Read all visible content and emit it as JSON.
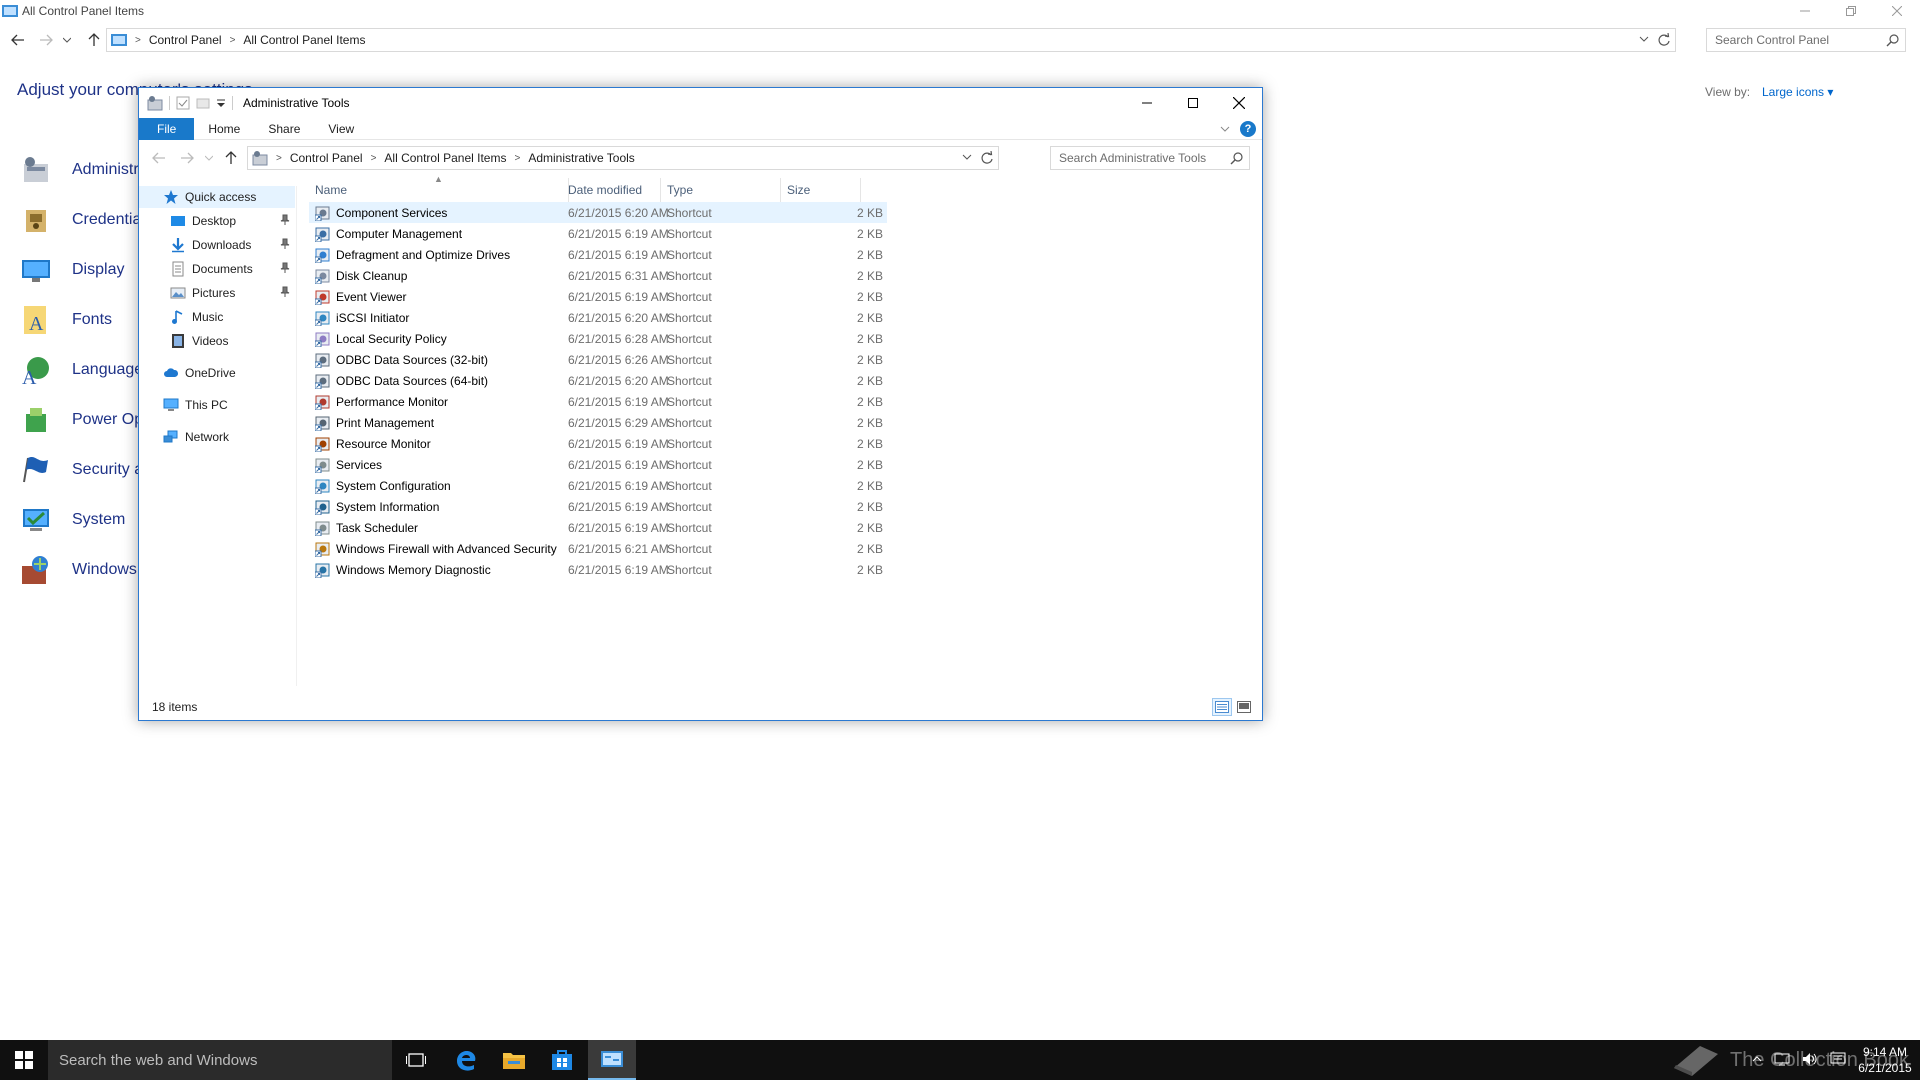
{
  "background_window": {
    "title": "All Control Panel Items",
    "address": [
      "Control Panel",
      "All Control Panel Items"
    ],
    "search_placeholder": "Search Control Panel",
    "heading": "Adjust your computer's settings",
    "view_by_label": "View by:",
    "view_by_value": "Large icons",
    "items": [
      {
        "label": "Administrative Tools",
        "icon": "admin-tools-icon"
      },
      {
        "label": "Credential Manager",
        "icon": "credential-icon"
      },
      {
        "label": "Display",
        "icon": "display-icon"
      },
      {
        "label": "Fonts",
        "icon": "fonts-icon"
      },
      {
        "label": "Language",
        "icon": "language-icon"
      },
      {
        "label": "Power Options",
        "icon": "power-icon"
      },
      {
        "label": "Security and Maintenance",
        "icon": "flag-icon"
      },
      {
        "label": "System",
        "icon": "system-icon"
      },
      {
        "label": "Windows Firewall",
        "icon": "firewall-icon"
      }
    ]
  },
  "explorer": {
    "title": "Administrative Tools",
    "ribbon_tabs": [
      "File",
      "Home",
      "Share",
      "View"
    ],
    "address": [
      "Control Panel",
      "All Control Panel Items",
      "Administrative Tools"
    ],
    "search_placeholder": "Search Administrative Tools",
    "nav": [
      {
        "label": "Quick access",
        "icon": "star-icon",
        "pinned": false
      },
      {
        "label": "Desktop",
        "icon": "desktop-icon",
        "pinned": true
      },
      {
        "label": "Downloads",
        "icon": "download-icon",
        "pinned": true
      },
      {
        "label": "Documents",
        "icon": "documents-icon",
        "pinned": true
      },
      {
        "label": "Pictures",
        "icon": "pictures-icon",
        "pinned": true
      },
      {
        "label": "Music",
        "icon": "music-icon",
        "pinned": false
      },
      {
        "label": "Videos",
        "icon": "videos-icon",
        "pinned": false
      },
      {
        "label": "OneDrive",
        "icon": "cloud-icon",
        "pinned": false
      },
      {
        "label": "This PC",
        "icon": "computer-icon",
        "pinned": false
      },
      {
        "label": "Network",
        "icon": "network-icon",
        "pinned": false
      }
    ],
    "columns": [
      "Name",
      "Date modified",
      "Type",
      "Size"
    ],
    "files": [
      {
        "name": "Component Services",
        "date": "6/21/2015 6:20 AM",
        "type": "Shortcut",
        "size": "2 KB"
      },
      {
        "name": "Computer Management",
        "date": "6/21/2015 6:19 AM",
        "type": "Shortcut",
        "size": "2 KB"
      },
      {
        "name": "Defragment and Optimize Drives",
        "date": "6/21/2015 6:19 AM",
        "type": "Shortcut",
        "size": "2 KB"
      },
      {
        "name": "Disk Cleanup",
        "date": "6/21/2015 6:31 AM",
        "type": "Shortcut",
        "size": "2 KB"
      },
      {
        "name": "Event Viewer",
        "date": "6/21/2015 6:19 AM",
        "type": "Shortcut",
        "size": "2 KB"
      },
      {
        "name": "iSCSI Initiator",
        "date": "6/21/2015 6:20 AM",
        "type": "Shortcut",
        "size": "2 KB"
      },
      {
        "name": "Local Security Policy",
        "date": "6/21/2015 6:28 AM",
        "type": "Shortcut",
        "size": "2 KB"
      },
      {
        "name": "ODBC Data Sources (32-bit)",
        "date": "6/21/2015 6:26 AM",
        "type": "Shortcut",
        "size": "2 KB"
      },
      {
        "name": "ODBC Data Sources (64-bit)",
        "date": "6/21/2015 6:20 AM",
        "type": "Shortcut",
        "size": "2 KB"
      },
      {
        "name": "Performance Monitor",
        "date": "6/21/2015 6:19 AM",
        "type": "Shortcut",
        "size": "2 KB"
      },
      {
        "name": "Print Management",
        "date": "6/21/2015 6:29 AM",
        "type": "Shortcut",
        "size": "2 KB"
      },
      {
        "name": "Resource Monitor",
        "date": "6/21/2015 6:19 AM",
        "type": "Shortcut",
        "size": "2 KB"
      },
      {
        "name": "Services",
        "date": "6/21/2015 6:19 AM",
        "type": "Shortcut",
        "size": "2 KB"
      },
      {
        "name": "System Configuration",
        "date": "6/21/2015 6:19 AM",
        "type": "Shortcut",
        "size": "2 KB"
      },
      {
        "name": "System Information",
        "date": "6/21/2015 6:19 AM",
        "type": "Shortcut",
        "size": "2 KB"
      },
      {
        "name": "Task Scheduler",
        "date": "6/21/2015 6:19 AM",
        "type": "Shortcut",
        "size": "2 KB"
      },
      {
        "name": "Windows Firewall with Advanced Security",
        "date": "6/21/2015 6:21 AM",
        "type": "Shortcut",
        "size": "2 KB"
      },
      {
        "name": "Windows Memory Diagnostic",
        "date": "6/21/2015 6:19 AM",
        "type": "Shortcut",
        "size": "2 KB"
      }
    ],
    "status": "18 items"
  },
  "taskbar": {
    "search_placeholder": "Search the web and Windows",
    "apps": [
      "task-view-icon",
      "edge-icon",
      "file-explorer-icon",
      "store-icon",
      "control-panel-icon"
    ],
    "watermark": "The Collection Book",
    "time": "9:14 AM",
    "date": "6/21/2015"
  },
  "colors": {
    "accent": "#1979ca",
    "cp_link": "#1e3287",
    "taskbar": "#101010"
  }
}
